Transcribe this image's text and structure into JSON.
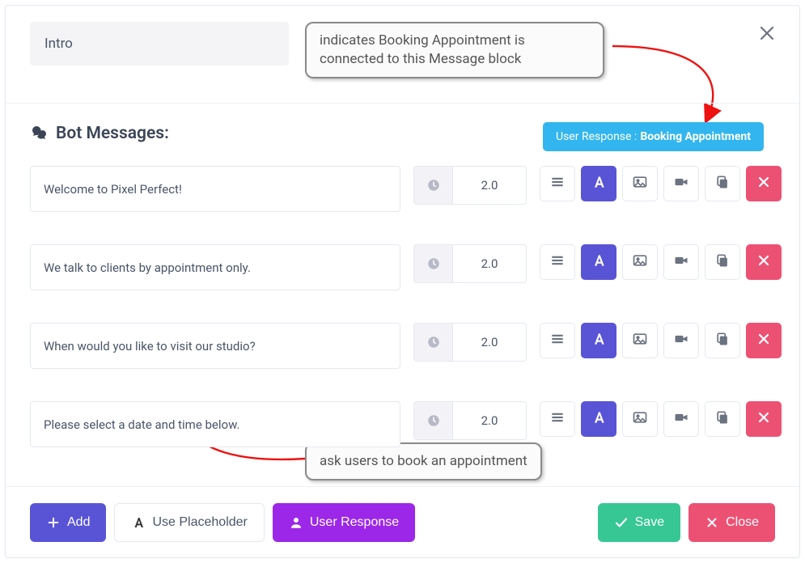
{
  "title": "Intro",
  "close_x_icon": "×",
  "callouts": {
    "top": "indicates Booking Appointment is connected to this Message block",
    "bottom": "ask users to book an appointment"
  },
  "section_title": "Bot Messages:",
  "user_response_badge": {
    "label": "User Response :",
    "value": "Booking Appointment"
  },
  "messages": [
    {
      "text": "Welcome to Pixel Perfect!",
      "delay": "2.0"
    },
    {
      "text": "We talk to clients by appointment only.",
      "delay": "2.0"
    },
    {
      "text": "When would you like to visit our studio?",
      "delay": "2.0"
    },
    {
      "text": "Please select a date and time below.",
      "delay": "2.0"
    }
  ],
  "tool_icons": {
    "drag": "drag-handle-icon",
    "text": "text-format-icon",
    "image": "image-icon",
    "video": "video-icon",
    "copy": "copy-icon",
    "delete": "close-icon"
  },
  "footer": {
    "add": "Add",
    "placeholder": "Use Placeholder",
    "user_response": "User Response",
    "save": "Save",
    "close": "Close"
  },
  "colors": {
    "primary_purple": "#5954d6",
    "accent_purple": "#9c27e8",
    "blue": "#33b5ef",
    "green": "#36c795",
    "red": "#ec5174"
  }
}
